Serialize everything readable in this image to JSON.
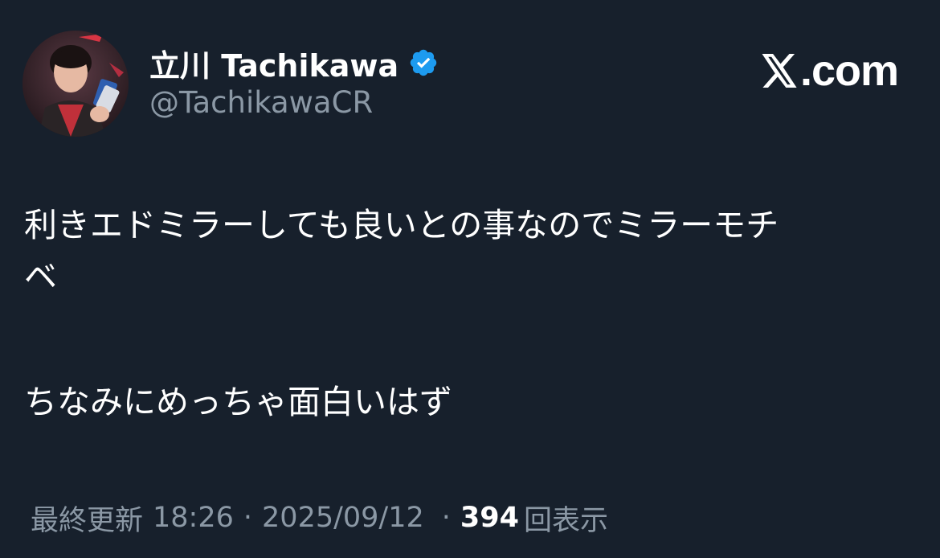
{
  "author": {
    "display_name": "立川 Tachikawa",
    "handle": "@TachikawaCR",
    "verified": true
  },
  "brand": {
    "logo_icon": "x-logo-icon",
    "domain": ".com"
  },
  "tweet": {
    "line1": "利きエドミラーしても良いとの事なのでミラーモチ",
    "line1_wrap": "ベ",
    "line2": "ちなみにめっちゃ面白いはず"
  },
  "meta": {
    "label": "最終更新",
    "time": "18:26",
    "sep1": "·",
    "date": "2025/09/12",
    "sep2": "·",
    "views_count": "394",
    "views_label": "回表示"
  },
  "colors": {
    "background": "#17202c",
    "text_primary": "#ffffff",
    "text_secondary": "#8b98a5",
    "verified_blue": "#1d9bf0"
  }
}
